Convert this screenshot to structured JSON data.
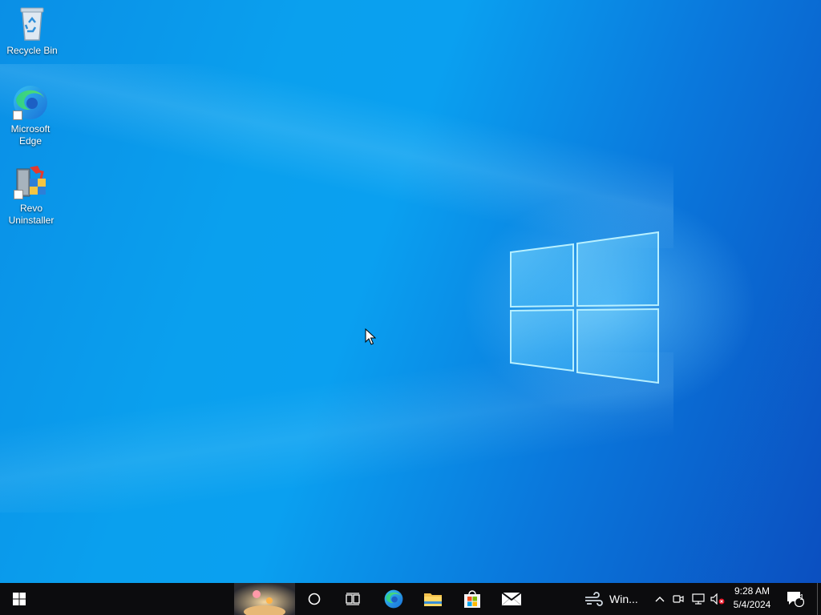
{
  "desktop_icons": [
    {
      "label": "Recycle Bin",
      "icon": "recycle-bin-icon"
    },
    {
      "label": "Microsoft Edge",
      "icon": "edge-icon"
    },
    {
      "label": "Revo Uninstaller",
      "icon": "revo-uninstaller-icon"
    }
  ],
  "taskbar": {
    "weather_label": "Win...",
    "clock_time": "9:28 AM",
    "clock_date": "5/4/2024",
    "notification_count": "1",
    "pinned": [
      "edge-icon",
      "file-explorer-icon",
      "microsoft-store-icon",
      "mail-icon"
    ]
  },
  "colors": {
    "taskbar_bg": "#0c0c0e",
    "desktop_blue": "#0a9aee",
    "accent": "#0078d7"
  }
}
